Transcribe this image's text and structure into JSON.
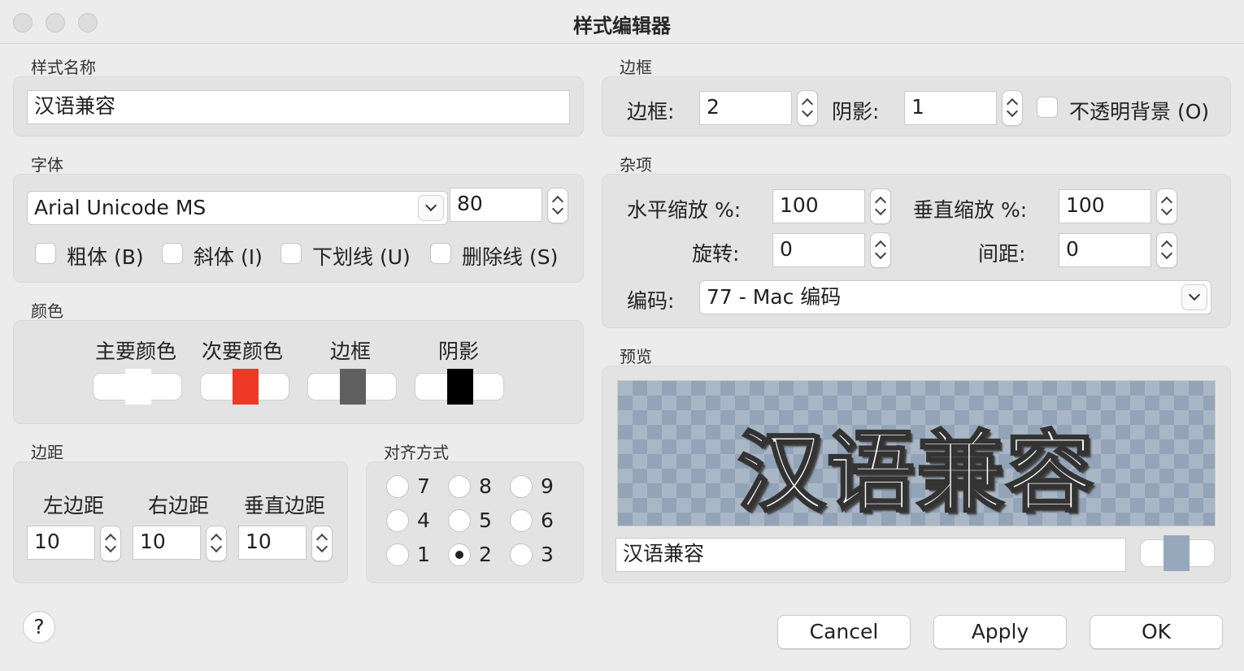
{
  "window": {
    "title": "样式编辑器"
  },
  "style_name": {
    "section": "样式名称",
    "value": "汉语兼容"
  },
  "font": {
    "section": "字体",
    "family": "Arial Unicode MS",
    "size": "80",
    "bold": "粗体 (B)",
    "italic": "斜体 (I)",
    "underline": "下划线 (U)",
    "strike": "删除线 (S)"
  },
  "colors": {
    "section": "颜色",
    "primary": {
      "label": "主要颜色",
      "color": "#ffffff"
    },
    "secondary": {
      "label": "次要颜色",
      "color": "#ee3a24"
    },
    "outline": {
      "label": "边框",
      "color": "#5f5f5f"
    },
    "shadow": {
      "label": "阴影",
      "color": "#000000"
    }
  },
  "margins": {
    "section": "边距",
    "left_label": "左边距",
    "left": "10",
    "right_label": "右边距",
    "right": "10",
    "vertical_label": "垂直边距",
    "vertical": "10"
  },
  "alignment": {
    "section": "对齐方式",
    "options": [
      "7",
      "8",
      "9",
      "4",
      "5",
      "6",
      "1",
      "2",
      "3"
    ],
    "selected": "2"
  },
  "border": {
    "section": "边框",
    "outline_label": "边框:",
    "outline": "2",
    "shadow_label": "阴影:",
    "shadow": "1",
    "opaque_label": "不透明背景 (O)"
  },
  "misc": {
    "section": "杂项",
    "scale_x_label": "水平缩放 %:",
    "scale_x": "100",
    "scale_y_label": "垂直缩放 %:",
    "scale_y": "100",
    "rotation_label": "旋转:",
    "rotation": "0",
    "spacing_label": "间距:",
    "spacing": "0",
    "encoding_label": "编码:",
    "encoding": "77 - Mac 编码"
  },
  "preview": {
    "section": "预览",
    "text": "汉语兼容",
    "sample_text": "汉语兼容",
    "bg_color": "#97a8bc"
  },
  "buttons": {
    "help": "?",
    "cancel": "Cancel",
    "apply": "Apply",
    "ok": "OK"
  }
}
